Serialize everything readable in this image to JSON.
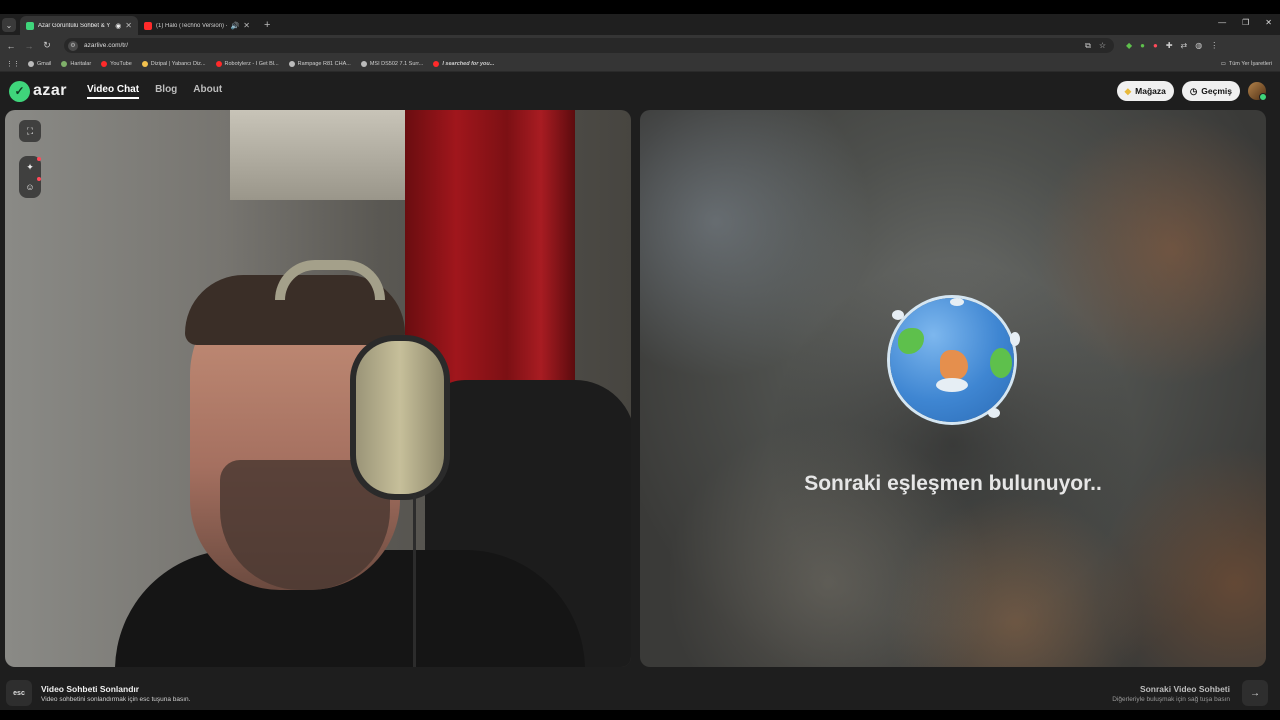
{
  "browser": {
    "tabs": [
      {
        "title": "Azar Görüntülü Sohbet & Y",
        "active": true,
        "favicon_color": "#3fd57b"
      },
      {
        "title": "(1) Halo (Techno Version) -",
        "active": false,
        "favicon_color": "#ff2a2a"
      }
    ],
    "address": "azarlive.com/tr/",
    "bookmarks": [
      {
        "label": "Gmail",
        "color": "#bbbbbb"
      },
      {
        "label": "Haritalar",
        "color": "#7fb06a"
      },
      {
        "label": "YouTube",
        "color": "#ff2a2a"
      },
      {
        "label": "Dizipal | Yabancı Diz...",
        "color": "#f2c14e"
      },
      {
        "label": "Robotylerz - I Get Bl...",
        "color": "#ff2a2a"
      },
      {
        "label": "Rampage R81 CHA...",
        "color": "#bbbbbb"
      },
      {
        "label": "MSI DS502 7.1 Surr...",
        "color": "#bbbbbb"
      },
      {
        "label": "I searched for you...",
        "color": "#ff2a2a"
      }
    ],
    "all_bookmarks": "Tüm Yer İşaretleri"
  },
  "header": {
    "logo_text": "azar",
    "nav": [
      {
        "label": "Video Chat",
        "active": true
      },
      {
        "label": "Blog",
        "active": false
      },
      {
        "label": "About",
        "active": false
      }
    ],
    "store_label": "Mağaza",
    "history_label": "Geçmiş"
  },
  "right_panel": {
    "status_text": "Sonraki eşleşmen bulunuyor.."
  },
  "footer": {
    "esc_key": "esc",
    "end_title": "Video Sohbeti Sonlandır",
    "end_sub": "Video sohbetini sonlandırmak için esc tuşuna basın.",
    "next_title": "Sonraki Video Sohbeti",
    "next_sub": "Diğerleriyle buluşmak için sağ tuşa basın"
  }
}
